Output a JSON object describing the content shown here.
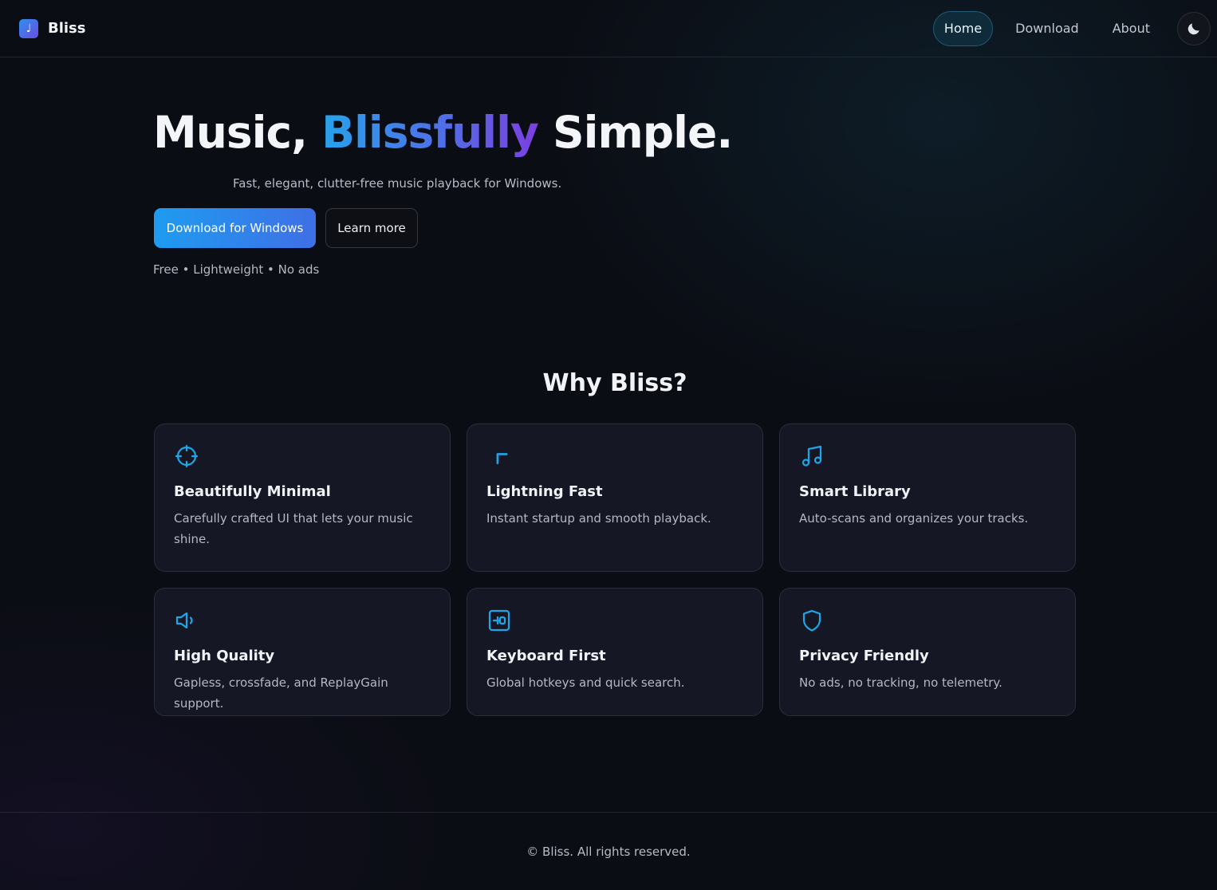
{
  "header": {
    "logo_icon": "music-note-icon",
    "brand": "Bliss",
    "nav": [
      {
        "label": "Home",
        "active": true
      },
      {
        "label": "Download",
        "active": false
      },
      {
        "label": "About",
        "active": false
      }
    ],
    "theme_toggle_icon": "moon-icon"
  },
  "hero": {
    "title_part1": "Music, ",
    "title_highlight": "Blissfully",
    "title_part2": " Simple.",
    "subtitle": "Fast, elegant, clutter-free music playback for Windows.",
    "primary_button": "Download for Windows",
    "secondary_button": "Learn more",
    "tagline": "Free • Lightweight • No ads"
  },
  "features": {
    "title": "Why Bliss?",
    "cards": [
      {
        "icon": "crosshair-icon",
        "title": "Beautifully Minimal",
        "description": "Carefully crafted UI that lets your music shine."
      },
      {
        "icon": "chevron-up-left-icon",
        "title": "Lightning Fast",
        "description": "Instant startup and smooth playback."
      },
      {
        "icon": "music-notes-icon",
        "title": "Smart Library",
        "description": "Auto-scans and organizes your tracks."
      },
      {
        "icon": "speaker-icon",
        "title": "High Quality",
        "description": "Gapless, crossfade, and ReplayGain support."
      },
      {
        "icon": "keyboard-icon",
        "title": "Keyboard First",
        "description": "Global hotkeys and quick search."
      },
      {
        "icon": "shield-icon",
        "title": "Privacy Friendly",
        "description": "No ads, no tracking, no telemetry."
      }
    ]
  },
  "footer": {
    "copyright": "© Bliss. All rights reserved."
  },
  "colors": {
    "accent": "#1e9cf0",
    "accent_purple": "#7c3fe0",
    "background": "#0b0d14",
    "card": "#151824"
  }
}
